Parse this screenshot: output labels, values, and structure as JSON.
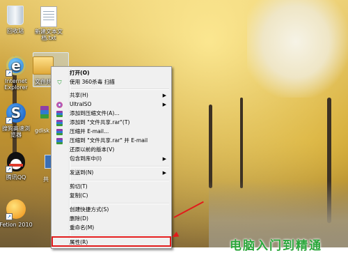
{
  "desktop": {
    "icons": {
      "recycle_bin": "回收站",
      "new_text_file": "新建文本文\n档.txt",
      "internet_explorer": "Internet\nExplorer",
      "sogou_browser": "搜狗高速浏\n览器",
      "tencent_qq": "腾讯QQ",
      "fetion": "Fetion 2010",
      "selected_folder_partial": "文件共",
      "gdisk_partial": "gdisk",
      "partial_bottom_label": "共"
    }
  },
  "context_menu": {
    "items": [
      {
        "label": "打开(O)",
        "bold": true
      },
      {
        "label": "使用 360杀毒 扫描",
        "icon": "shield-icon"
      },
      {
        "label": "共享(H)",
        "submenu": true
      },
      {
        "label": "UltraISO",
        "submenu": true,
        "icon": "disc-icon"
      },
      {
        "label": "添加到压缩文件(A)...",
        "icon": "winrar-icon"
      },
      {
        "label": "添加到 \"文件共享.rar\"(T)",
        "icon": "winrar-icon"
      },
      {
        "label": "压缩并 E-mail...",
        "icon": "winrar-icon"
      },
      {
        "label": "压缩到 \"文件共享.rar\" 并 E-mail",
        "icon": "winrar-icon"
      },
      {
        "label": "还原以前的版本(V)"
      },
      {
        "label": "包含到库中(I)",
        "submenu": true
      },
      {
        "label": "发送到(N)",
        "submenu": true
      },
      {
        "label": "剪切(T)"
      },
      {
        "label": "复制(C)"
      },
      {
        "label": "创建快捷方式(S)"
      },
      {
        "label": "删除(D)"
      },
      {
        "label": "重命名(M)"
      },
      {
        "label": "属性(R)"
      }
    ],
    "submenu_arrow": "▶"
  },
  "annotation": {
    "highlight_color": "#e21b1b"
  },
  "watermark": "电脑入门到精通"
}
